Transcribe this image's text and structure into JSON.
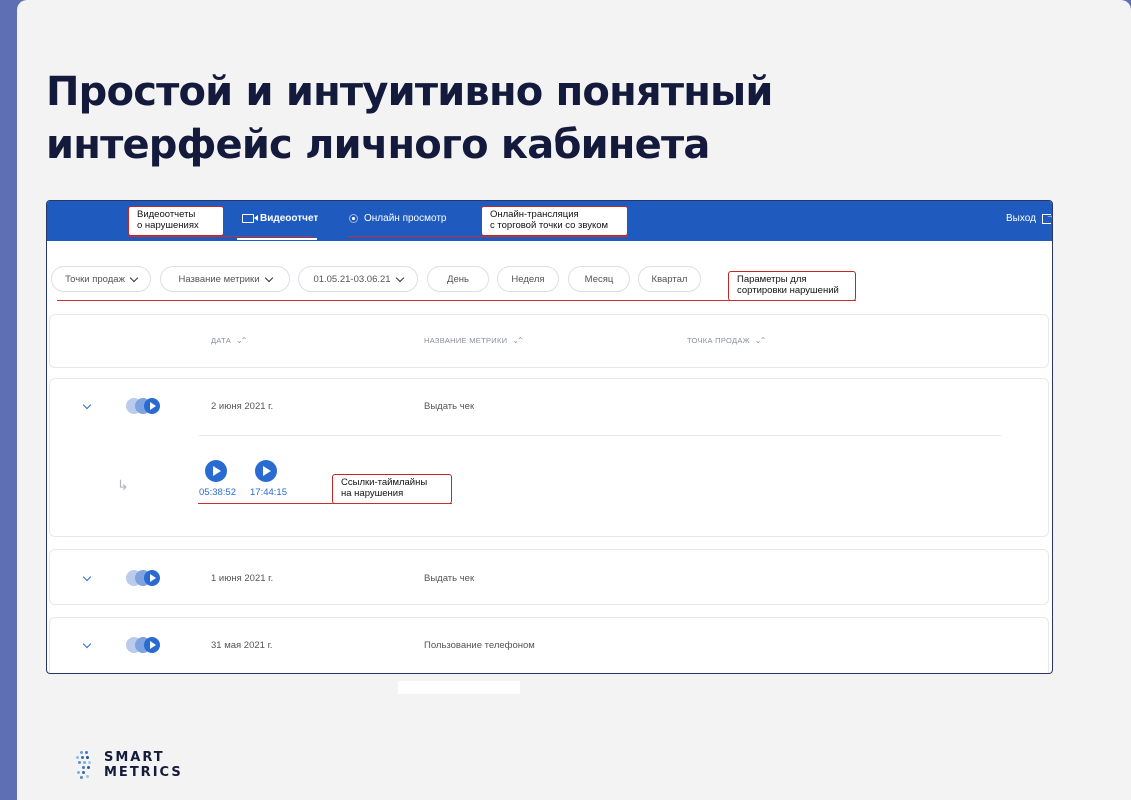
{
  "slide": {
    "title_line1": "Простой и интуитивно понятный",
    "title_line2": "интерфейс личного кабинета"
  },
  "topbar": {
    "tab_video": "Видеоотчет",
    "tab_online": "Онлайн просмотр",
    "logout": "Выход"
  },
  "callouts": {
    "video_reports_1": "Видеоотчеты",
    "video_reports_2": "о нарушениях",
    "online_1": "Онлайн-трансляция",
    "online_2": "с торговой точки со звуком",
    "params_1": "Параметры для",
    "params_2": "сортировки нарушений",
    "links_1": "Ссылки-таймлайны",
    "links_2": "на нарушения"
  },
  "filters": {
    "points": "Точки продаж",
    "metric": "Название метрики",
    "range": "01.05.21-03.06.21",
    "day": "День",
    "week": "Неделя",
    "month": "Месяц",
    "quarter": "Квартал"
  },
  "table": {
    "headers": {
      "date": "ДАТА",
      "metric": "НАЗВАНИЕ МЕТРИКИ",
      "point": "ТОЧКА ПРОДАЖ"
    },
    "rows": [
      {
        "date": "2 июня 2021 г.",
        "metric": "Выдать чек",
        "expanded": true,
        "timelines": [
          "05:38:52",
          "17:44:15"
        ]
      },
      {
        "date": "1 июня 2021 г.",
        "metric": "Выдать чек"
      },
      {
        "date": "31 мая 2021 г.",
        "metric": "Пользование телефоном"
      }
    ]
  },
  "logo": {
    "line1": "SMART",
    "line2": "METRICS"
  },
  "colors": {
    "background": "#5f6fb4",
    "slide": "#f3f3f4",
    "topbar": "#1f5bbf",
    "accent": "#2a6bd1",
    "callout_border": "#c02828",
    "title": "#141a3b"
  }
}
